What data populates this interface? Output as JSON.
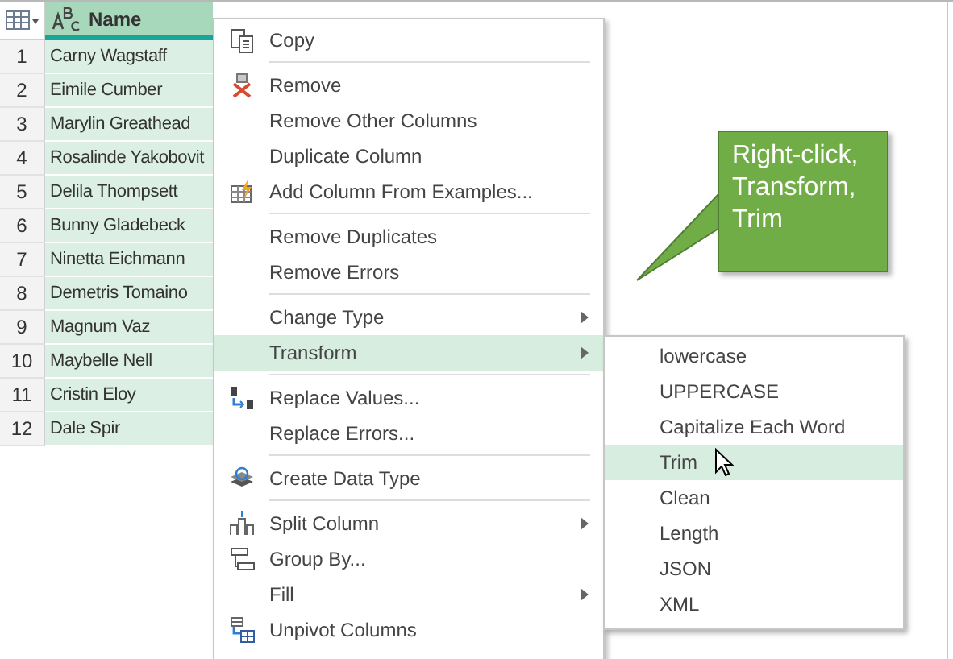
{
  "table": {
    "columns": [
      {
        "label": "Name",
        "selected": true
      }
    ],
    "rows": [
      {
        "number": "1",
        "name": "Carny Wagstaff"
      },
      {
        "number": "2",
        "name": "Eimile Cumber"
      },
      {
        "number": "3",
        "name": "Marylin Greathead"
      },
      {
        "number": "4",
        "name": "Rosalinde Yakobovit"
      },
      {
        "number": "5",
        "name": "Delila Thompsett"
      },
      {
        "number": "6",
        "name": "Bunny Gladebeck"
      },
      {
        "number": "7",
        "name": "Ninetta Eichmann"
      },
      {
        "number": "8",
        "name": "Demetris Tomaino"
      },
      {
        "number": "9",
        "name": "Magnum Vaz"
      },
      {
        "number": "10",
        "name": "Maybelle Nell"
      },
      {
        "number": "11",
        "name": "Cristin Eloy"
      },
      {
        "number": "12",
        "name": "Dale Spir"
      }
    ]
  },
  "context_menu": {
    "groups": [
      [
        {
          "label": "Copy",
          "selected": false,
          "submenu": false
        }
      ],
      [
        {
          "label": "Remove",
          "selected": false,
          "submenu": false
        },
        {
          "label": "Remove Other Columns",
          "selected": false,
          "submenu": false
        },
        {
          "label": "Duplicate Column",
          "selected": false,
          "submenu": false
        },
        {
          "label": "Add Column From Examples...",
          "selected": false,
          "submenu": false
        }
      ],
      [
        {
          "label": "Remove Duplicates",
          "selected": false,
          "submenu": false
        },
        {
          "label": "Remove Errors",
          "selected": false,
          "submenu": false
        }
      ],
      [
        {
          "label": "Change Type",
          "selected": false,
          "submenu": true
        },
        {
          "label": "Transform",
          "selected": true,
          "submenu": true
        }
      ],
      [
        {
          "label": "Replace Values...",
          "selected": false,
          "submenu": false
        },
        {
          "label": "Replace Errors...",
          "selected": false,
          "submenu": false
        }
      ],
      [
        {
          "label": "Create Data Type",
          "selected": false,
          "submenu": false
        }
      ],
      [
        {
          "label": "Split Column",
          "selected": false,
          "submenu": true
        },
        {
          "label": "Group By...",
          "selected": false,
          "submenu": false
        },
        {
          "label": "Fill",
          "selected": false,
          "submenu": true
        },
        {
          "label": "Unpivot Columns",
          "selected": false,
          "submenu": false
        }
      ]
    ]
  },
  "submenu": {
    "items": [
      {
        "label": "lowercase",
        "selected": false
      },
      {
        "label": "UPPERCASE",
        "selected": false
      },
      {
        "label": "Capitalize Each Word",
        "selected": false
      },
      {
        "label": "Trim",
        "selected": true
      },
      {
        "label": "Clean",
        "selected": false
      },
      {
        "label": "Length",
        "selected": false
      },
      {
        "label": "JSON",
        "selected": false
      },
      {
        "label": "XML",
        "selected": false
      }
    ]
  },
  "callout": {
    "text": "Right-click, Transform, Trim"
  }
}
